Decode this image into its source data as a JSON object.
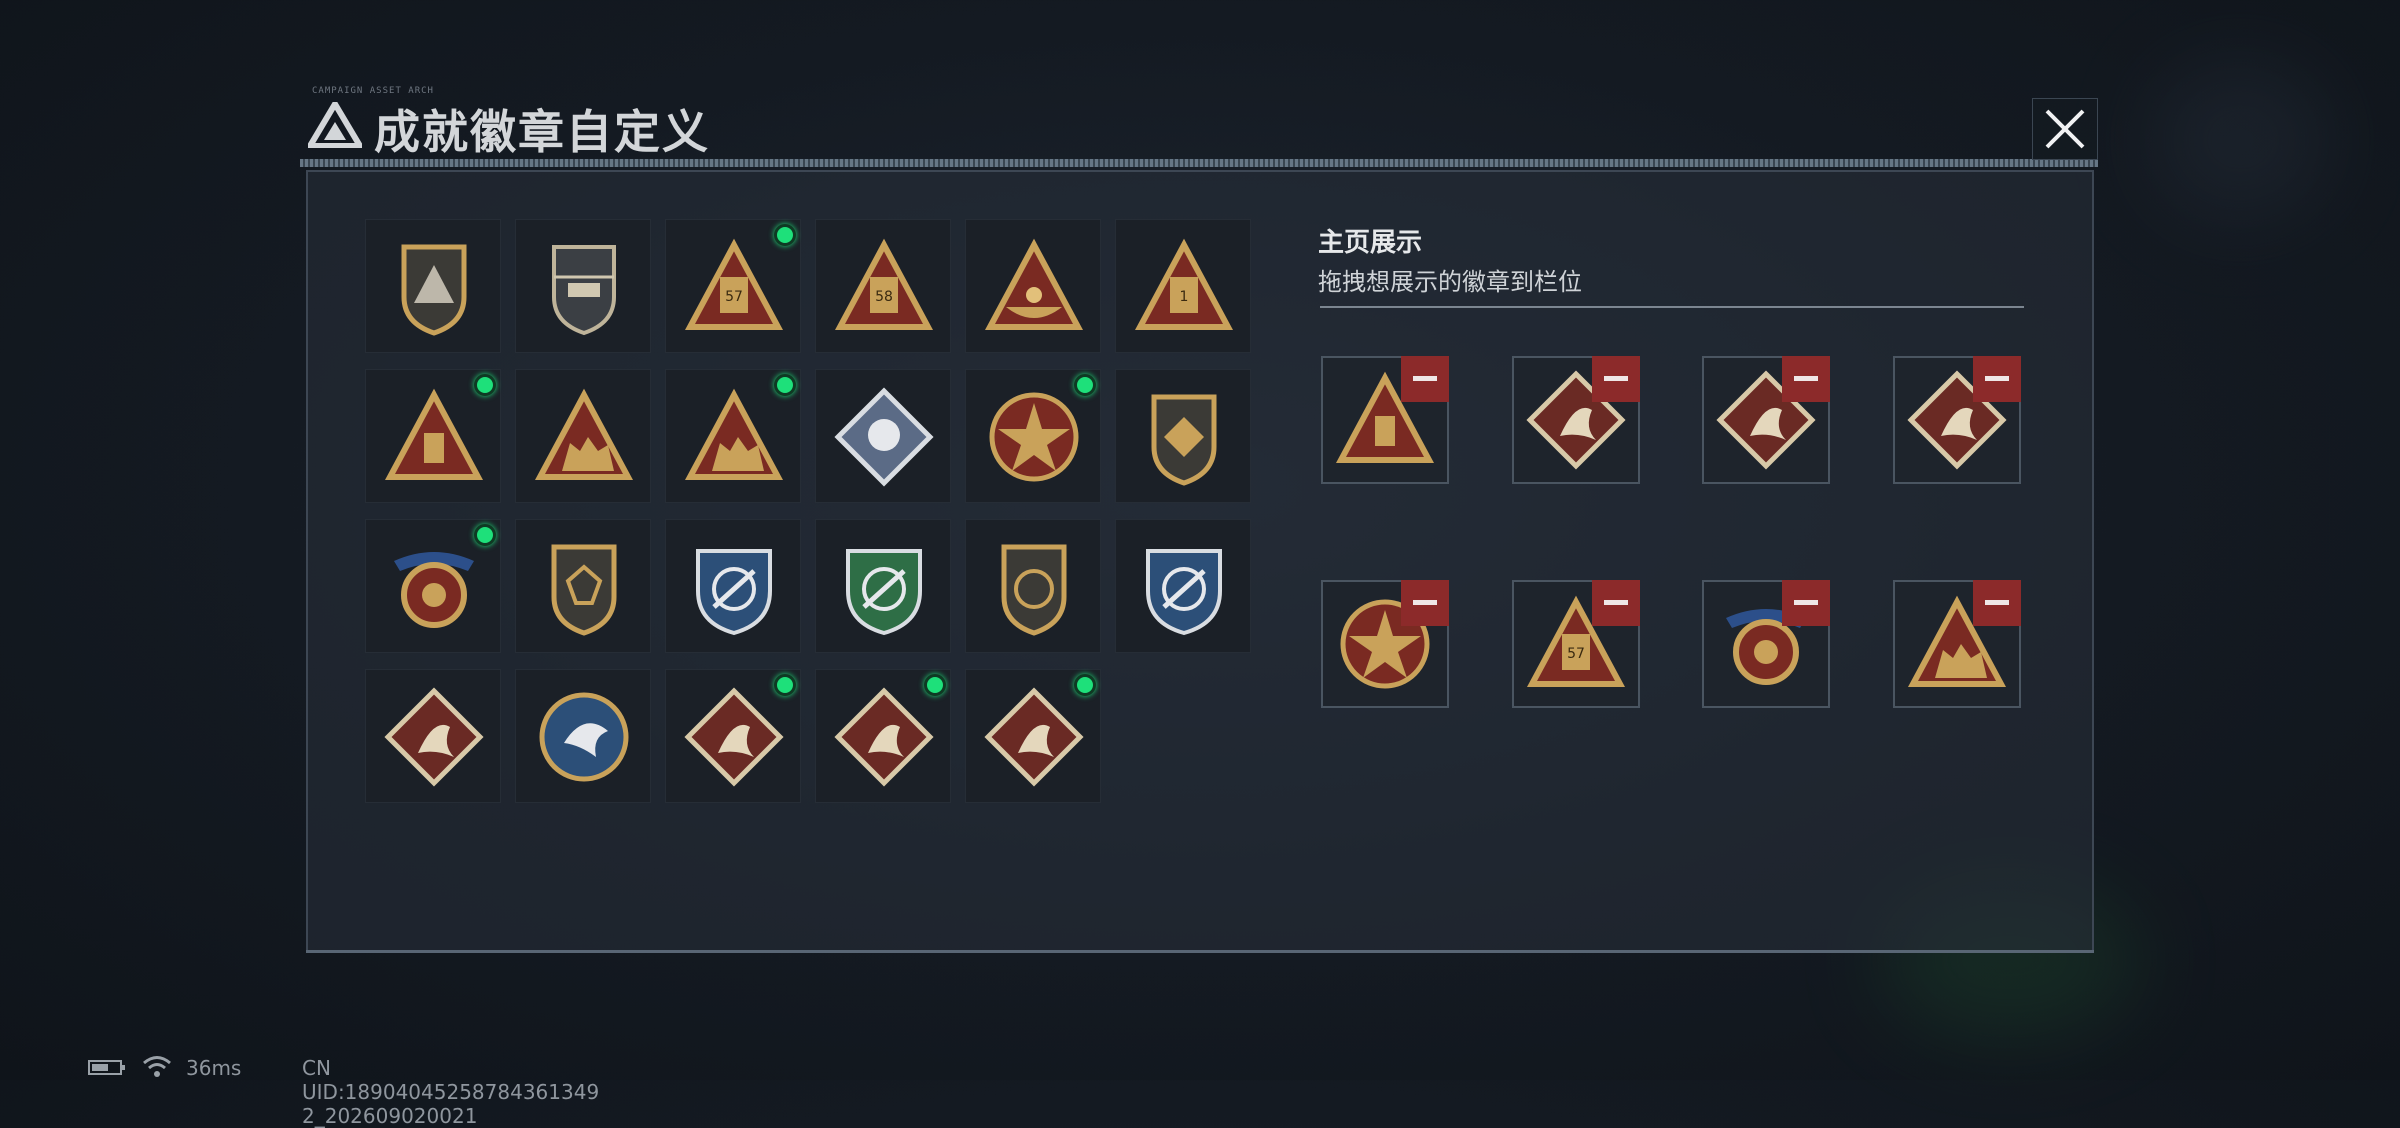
{
  "header": {
    "title": "成就徽章自定义",
    "micro_text": "CAMPAIGN ASSET ARCH",
    "close_icon": "close-icon"
  },
  "showcase": {
    "title": "主页展示",
    "subtitle": "拖拽想展示的徽章到栏位"
  },
  "badges": [
    {
      "icon": "shield-triangle-badge",
      "equipped": false
    },
    {
      "icon": "helicopter-badge",
      "equipped": false
    },
    {
      "icon": "triangle-57-badge",
      "equipped": true,
      "number": "57"
    },
    {
      "icon": "triangle-58-badge",
      "equipped": false,
      "number": "58"
    },
    {
      "icon": "triangle-eggs-badge",
      "equipped": false
    },
    {
      "icon": "triangle-1-badge",
      "equipped": false,
      "number": "1"
    },
    {
      "icon": "triangle-usb-badge",
      "equipped": true
    },
    {
      "icon": "triangle-soldiers-badge",
      "equipped": false
    },
    {
      "icon": "triangle-soldiers-gold-badge",
      "equipped": true
    },
    {
      "icon": "rose-diamond-badge",
      "equipped": false
    },
    {
      "icon": "star-round-badge",
      "equipped": true
    },
    {
      "icon": "shield-emblem-badge",
      "equipped": false
    },
    {
      "icon": "medal-ribbon-badge",
      "equipped": true
    },
    {
      "icon": "shield-gem-badge",
      "equipped": false
    },
    {
      "icon": "blue-crest-rifle-badge",
      "equipped": false
    },
    {
      "icon": "green-crest-rifle-badge",
      "equipped": false
    },
    {
      "icon": "shield-scope-badge",
      "equipped": false
    },
    {
      "icon": "blue-crest-knife-badge",
      "equipped": false
    },
    {
      "icon": "wolf-diamond-badge",
      "equipped": false
    },
    {
      "icon": "eagle-round-badge",
      "equipped": false
    },
    {
      "icon": "dragon-diamond-badge",
      "equipped": true
    },
    {
      "icon": "dragon-diamond-badge",
      "equipped": true
    },
    {
      "icon": "runner-diamond-badge",
      "equipped": true
    }
  ],
  "slots": [
    {
      "icon": "triangle-usb-badge",
      "remove_icon": "minus-icon"
    },
    {
      "icon": "runner-diamond-badge",
      "remove_icon": "minus-icon"
    },
    {
      "icon": "dragon-diamond-badge",
      "remove_icon": "minus-icon"
    },
    {
      "icon": "dragon-diamond-badge",
      "remove_icon": "minus-icon"
    },
    {
      "icon": "star-round-badge",
      "remove_icon": "minus-icon"
    },
    {
      "icon": "triangle-57-badge",
      "remove_icon": "minus-icon",
      "number": "57"
    },
    {
      "icon": "medal-ribbon-badge",
      "remove_icon": "minus-icon"
    },
    {
      "icon": "triangle-soldiers-gold-badge",
      "remove_icon": "minus-icon"
    }
  ],
  "status_bar": {
    "battery_icon": "battery-icon",
    "wifi_icon": "wifi-icon",
    "ping": "36ms",
    "uid": "CN UID:18904045258784361349​2_202609020021"
  },
  "colors": {
    "equipped_dot": "#1ee07a",
    "remove_button": "#8c2a2a",
    "badge_gold": "#c9a25a",
    "badge_red": "#7a2a22"
  }
}
